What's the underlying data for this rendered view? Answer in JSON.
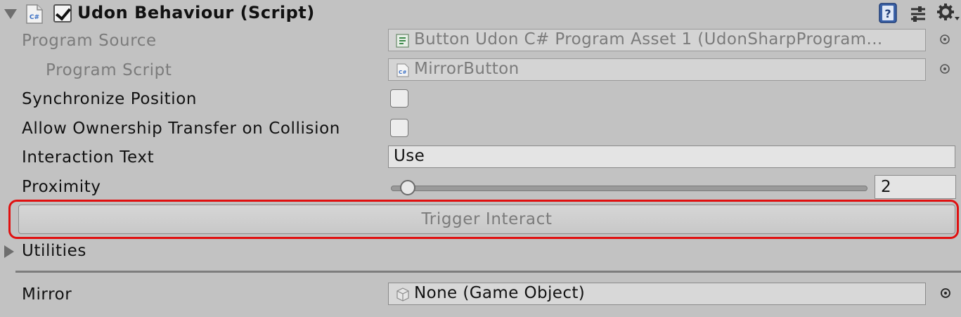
{
  "component": {
    "title": "Udon Behaviour (Script)",
    "enabled": true
  },
  "header_icons": [
    "cs-script-icon",
    "help-icon",
    "preset-icon",
    "gear-icon"
  ],
  "properties": {
    "program_source": {
      "label": "Program Source",
      "value": "Button Udon C# Program Asset 1 (UdonSharpProgram..."
    },
    "program_script": {
      "label": "Program Script",
      "value": "MirrorButton"
    },
    "synchronize_position": {
      "label": "Synchronize Position",
      "checked": false
    },
    "allow_ownership_transfer": {
      "label": "Allow Ownership Transfer on Collision",
      "checked": false
    },
    "interaction_text": {
      "label": "Interaction Text",
      "value": "Use"
    },
    "proximity": {
      "label": "Proximity",
      "value": "2",
      "slider_fraction": 0.02
    }
  },
  "trigger_button": {
    "label": "Trigger Interact",
    "highlight_color": "#e01010"
  },
  "utilities": {
    "label": "Utilities",
    "expanded": false
  },
  "public_variables": {
    "mirror": {
      "label": "Mirror",
      "value": "None (Game Object)"
    }
  }
}
